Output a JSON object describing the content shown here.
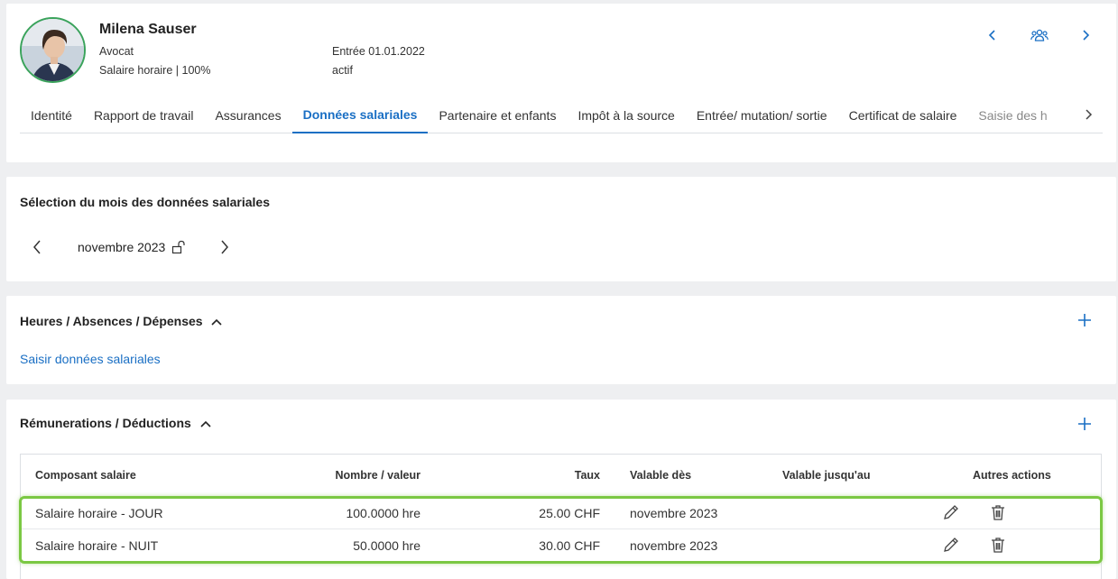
{
  "employee": {
    "name": "Milena Sauser",
    "role": "Avocat",
    "wage_info": "Salaire horaire | 100%",
    "entry": "Entrée 01.01.2022",
    "status": "actif"
  },
  "header_icons": [
    "chevron-left-icon",
    "group-icon",
    "chevron-right-icon"
  ],
  "tabs": [
    {
      "label": "Identité"
    },
    {
      "label": "Rapport de travail"
    },
    {
      "label": "Assurances"
    },
    {
      "label": "Données salariales"
    },
    {
      "label": "Partenaire et enfants"
    },
    {
      "label": "Impôt à la source"
    },
    {
      "label": "Entrée/ mutation/ sortie"
    },
    {
      "label": "Certificat de salaire"
    },
    {
      "label": "Saisie des h"
    }
  ],
  "active_tab": "Données salariales",
  "month_section": {
    "title": "Sélection du mois des données salariales",
    "month": "novembre 2023"
  },
  "hours_section": {
    "title": "Heures / Absences / Dépenses",
    "link": "Saisir données salariales"
  },
  "remuneration_section": {
    "title": "Rémunerations / Déductions",
    "columns": [
      "Composant salaire",
      "Nombre / valeur",
      "Taux",
      "Valable dès",
      "Valable jusqu'au",
      "Autres actions"
    ],
    "rows": [
      {
        "component": "Salaire horaire - JOUR",
        "quantity": "100.0000 hre",
        "rate": "25.00 CHF",
        "valid_from": "novembre 2023",
        "valid_to": ""
      },
      {
        "component": "Salaire horaire - NUIT",
        "quantity": "50.0000 hre",
        "rate": "30.00 CHF",
        "valid_from": "novembre 2023",
        "valid_to": ""
      }
    ]
  },
  "colors": {
    "accent": "#1a6fc4",
    "highlight": "#7bc843",
    "avatar_border": "#3aa35b"
  }
}
